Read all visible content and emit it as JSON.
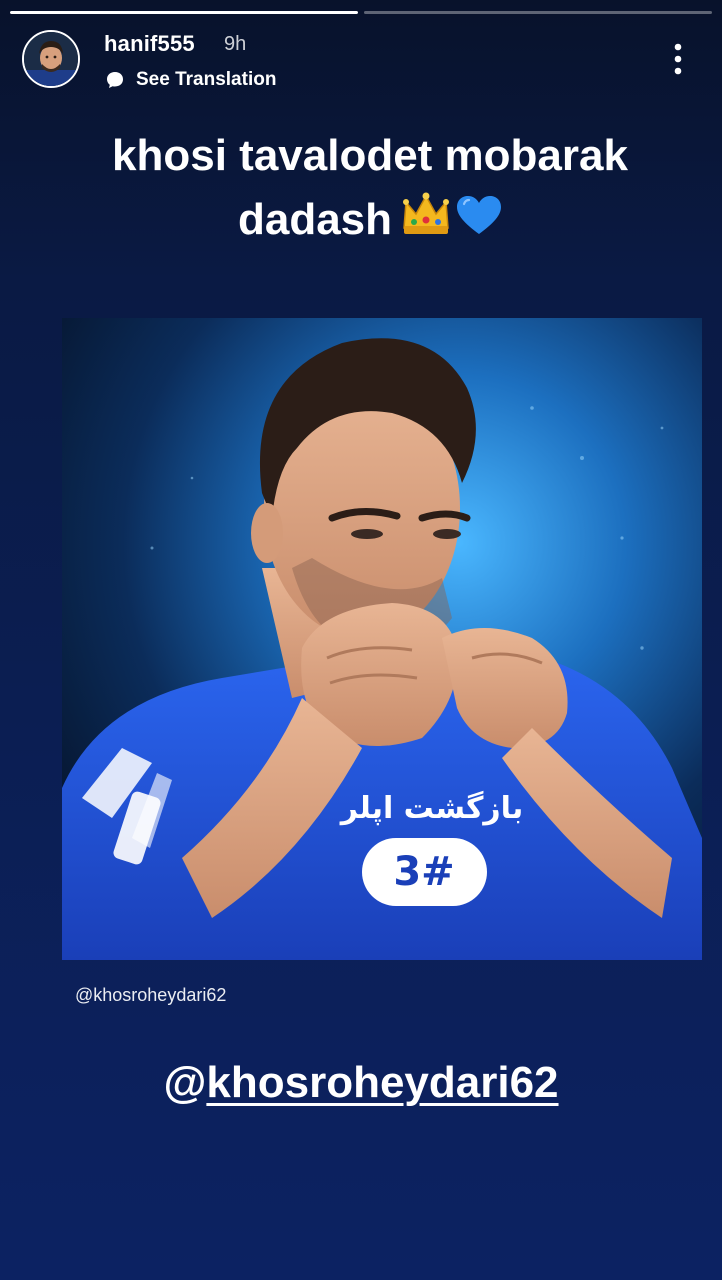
{
  "story": {
    "progress": [
      {
        "fraction": 1.0
      },
      {
        "fraction": 0.0
      }
    ],
    "header": {
      "username": "hanif555",
      "time_ago": "9h",
      "translation_label": "See Translation",
      "avatar_icon": "user-avatar",
      "more_icon": "more-vertical-icon"
    },
    "caption": {
      "line1": "khosi tavalodet mobarak",
      "line2": "dadash",
      "emoji": "👑💙"
    },
    "photo": {
      "description_icon": "footballer-photo",
      "jersey_text": "بازگشت اپلر"
    },
    "photo_credit": "@khosroheydari62",
    "mention": {
      "at": "@",
      "handle": "khosroheydari62"
    }
  },
  "colors": {
    "background_top": "#08122b",
    "background_bottom": "#0c2262",
    "jersey_blue": "#1f4fd8",
    "glow_blue": "#39a7ff"
  }
}
